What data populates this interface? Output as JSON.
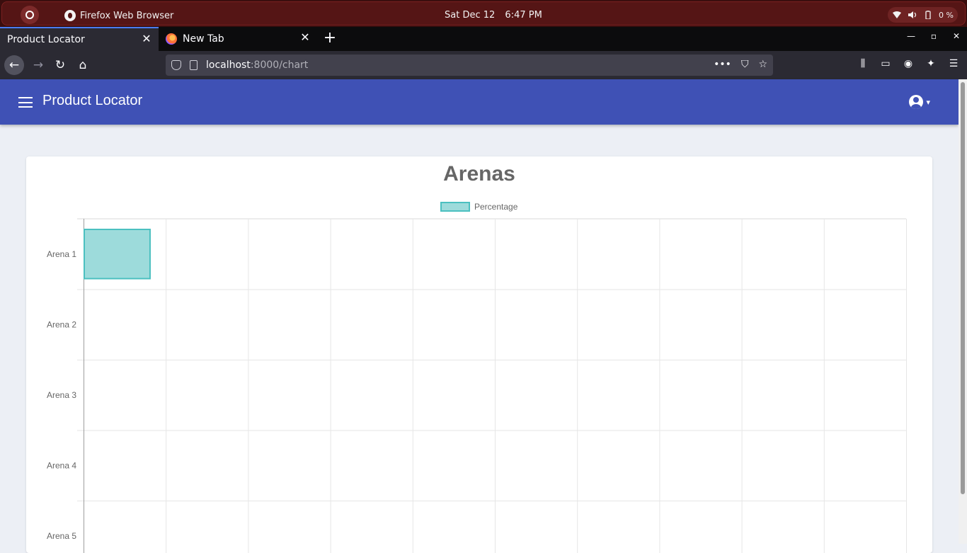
{
  "os_bar": {
    "app_name": "Firefox Web Browser",
    "date": "Sat Dec 12",
    "time": "6:47 PM",
    "battery": "0 %"
  },
  "browser": {
    "tabs": [
      {
        "title": "Product Locator",
        "active": true
      },
      {
        "title": "New Tab",
        "active": false
      }
    ],
    "url_host": "localhost",
    "url_path": ":8000/chart"
  },
  "app": {
    "title": "Product Locator"
  },
  "colors": {
    "app_header": "#3f51b5",
    "bar_fill": "#9ddbdb",
    "bar_border": "#4bc0c0"
  },
  "chart_data": {
    "type": "bar",
    "orientation": "horizontal",
    "title": "Arenas",
    "categories": [
      "Arena 1",
      "Arena 2",
      "Arena 3",
      "Arena 4",
      "Arena 5"
    ],
    "series": [
      {
        "name": "Percentage",
        "values": [
          0.8,
          0,
          0,
          0,
          0
        ]
      }
    ],
    "xlim": [
      0,
      10
    ],
    "grid": true,
    "legend_position": "top"
  }
}
